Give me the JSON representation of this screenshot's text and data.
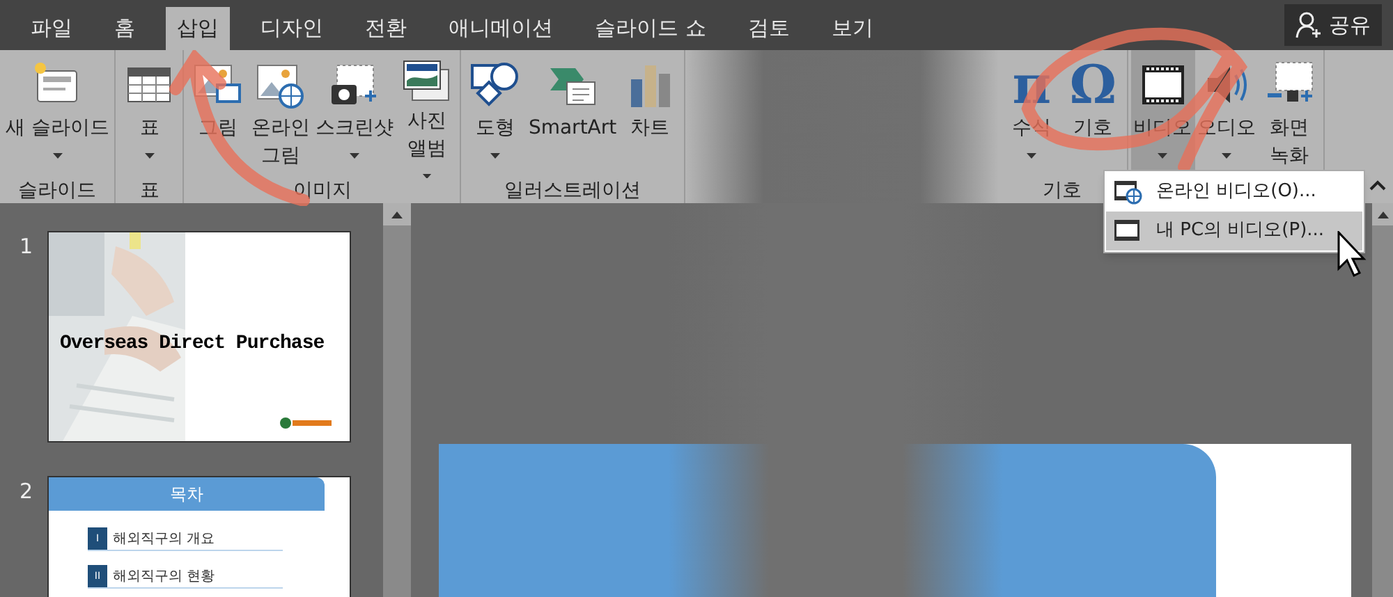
{
  "tabs": [
    {
      "label": "파일",
      "selected": false
    },
    {
      "label": "홈",
      "selected": false
    },
    {
      "label": "삽입",
      "selected": true
    },
    {
      "label": "디자인",
      "selected": false
    },
    {
      "label": "전환",
      "selected": false
    },
    {
      "label": "애니메이션",
      "selected": false
    },
    {
      "label": "슬라이드 쇼",
      "selected": false
    },
    {
      "label": "검토",
      "selected": false
    },
    {
      "label": "보기",
      "selected": false
    }
  ],
  "share": {
    "label": "공유"
  },
  "ribbon": {
    "groups": [
      {
        "kind": "group",
        "label": "슬라이드",
        "buttons": [
          {
            "label": "새 슬라이드",
            "kind": "new-slide",
            "dropdown": true,
            "pressed": false
          }
        ]
      },
      {
        "kind": "group",
        "label": "표",
        "buttons": [
          {
            "label": "표",
            "kind": "table",
            "dropdown": true,
            "pressed": false
          }
        ]
      },
      {
        "kind": "group",
        "label": "이미지",
        "buttons": [
          {
            "label": "그림",
            "kind": "picture",
            "dropdown": false,
            "pressed": false
          },
          {
            "label": "온라인 그림",
            "kind": "online-picture",
            "dropdown": false,
            "pressed": false
          },
          {
            "label": "스크린샷",
            "kind": "screenshot",
            "dropdown": true,
            "pressed": false
          },
          {
            "label": "사진 앨범",
            "kind": "album",
            "dropdown": true,
            "pressed": false
          }
        ]
      },
      {
        "kind": "group",
        "label": "일러스트레이션",
        "buttons": [
          {
            "label": "도형",
            "kind": "shapes",
            "dropdown": true,
            "pressed": false
          },
          {
            "label": "SmartArt",
            "kind": "smartart",
            "dropdown": false,
            "pressed": false
          },
          {
            "label": "차트",
            "kind": "chart",
            "dropdown": false,
            "pressed": false
          }
        ]
      },
      {
        "kind": "obscured"
      },
      {
        "kind": "group",
        "label": "기호",
        "buttons": [
          {
            "label": "수식",
            "kind": "glyph",
            "glyph": "π",
            "dropdown": true,
            "pressed": false
          },
          {
            "label": "기호",
            "kind": "glyph",
            "glyph": "Ω",
            "dropdown": false,
            "pressed": false
          }
        ]
      },
      {
        "kind": "group",
        "buttons": [
          {
            "label": "비디오",
            "kind": "video",
            "dropdown": true,
            "pressed": true
          },
          {
            "label": "오디오",
            "kind": "audio",
            "dropdown": true,
            "pressed": false
          },
          {
            "label": "화면 녹화",
            "kind": "screen-recording",
            "dropdown": false,
            "pressed": false
          }
        ]
      }
    ]
  },
  "menu": {
    "items": [
      {
        "label": "온라인 비디오(O)...",
        "kind": "online-video",
        "selected": false
      },
      {
        "label": "내 PC의 비디오(P)...",
        "kind": "video-file",
        "selected": true
      }
    ]
  },
  "slides": [
    {
      "number": "1",
      "kind": "title",
      "title": "Overseas Direct Purchase"
    },
    {
      "number": "2",
      "kind": "toc",
      "title": "목차",
      "items": [
        {
          "numeral": "I",
          "text": "해외직구의 개요"
        },
        {
          "numeral": "II",
          "text": "해외직구의 현황"
        }
      ]
    }
  ]
}
